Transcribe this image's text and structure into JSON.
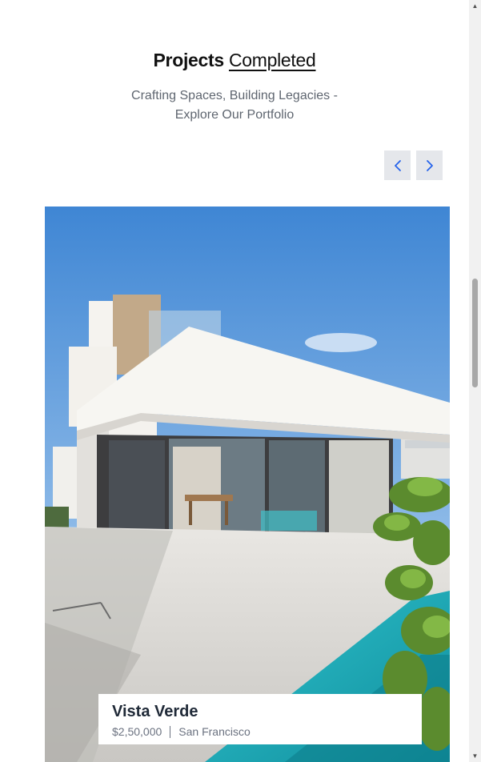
{
  "section": {
    "title_bold": "Projects",
    "title_underlined": "Completed",
    "subtitle": "Crafting Spaces, Building Legacies - Explore Our Portfolio"
  },
  "carousel": {
    "prev_icon": "chevron-left-icon",
    "next_icon": "chevron-right-icon",
    "accent_color": "#2563eb"
  },
  "project": {
    "name": "Vista Verde",
    "price": "$2,50,000",
    "location": "San Francisco"
  },
  "scrollbar": {
    "up_icon": "scroll-up-arrow-icon",
    "down_icon": "scroll-down-arrow-icon"
  }
}
